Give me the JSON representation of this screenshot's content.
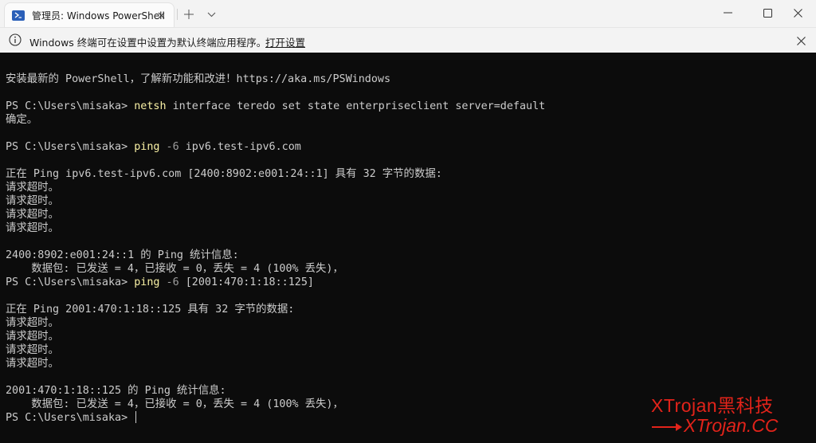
{
  "window": {
    "tab_title": "管理员: Windows PowerShell",
    "new_tab_symbol": "+",
    "dropdown_symbol": "⌄"
  },
  "infobar": {
    "message": "Windows 终端可在设置中设置为默认终端应用程序。",
    "link": "打开设置"
  },
  "terminal": {
    "l01": "安装最新的 PowerShell，了解新功能和改进！https://aka.ms/PSWindows",
    "p1_prompt": "PS C:\\Users\\misaka> ",
    "p1_cmd": "netsh",
    "p1_args": " interface teredo set state enterpriseclient server=default",
    "l03": "确定。",
    "p2_prompt": "PS C:\\Users\\misaka> ",
    "p2_cmd": "ping",
    "p2_flag": " -6",
    "p2_args": " ipv6.test-ipv6.com",
    "l05": "正在 Ping ipv6.test-ipv6.com [2400:8902:e001:24::1] 具有 32 字节的数据:",
    "l06": "请求超时。",
    "l07": "请求超时。",
    "l08": "请求超时。",
    "l09": "请求超时。",
    "l10": "2400:8902:e001:24::1 的 Ping 统计信息:",
    "l11": "    数据包: 已发送 = 4，已接收 = 0，丢失 = 4 (100% 丢失)，",
    "p3_prompt": "PS C:\\Users\\misaka> ",
    "p3_cmd": "ping",
    "p3_flag": " -6",
    "p3_args": " [2001:470:1:18::125]",
    "l13": "正在 Ping 2001:470:1:18::125 具有 32 字节的数据:",
    "l14": "请求超时。",
    "l15": "请求超时。",
    "l16": "请求超时。",
    "l17": "请求超时。",
    "l18": "2001:470:1:18::125 的 Ping 统计信息:",
    "l19": "    数据包: 已发送 = 4，已接收 = 0，丢失 = 4 (100% 丢失)，",
    "p4_prompt": "PS C:\\Users\\misaka> "
  },
  "watermark": {
    "line1": "XTrojan黑科技",
    "line2": "XTrojan.CC"
  },
  "colors": {
    "terminal_bg": "#0c0c0c",
    "terminal_fg": "#cccccc",
    "command": "#f9f1a5",
    "parameter": "#9d9d9d",
    "watermark": "#e2231a"
  }
}
